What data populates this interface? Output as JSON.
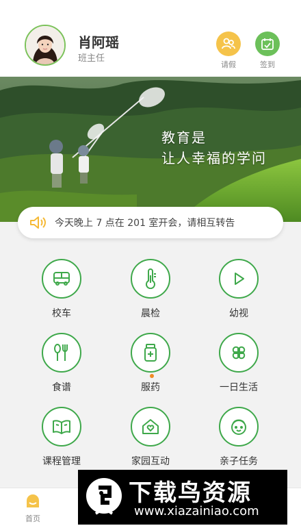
{
  "header": {
    "name": "肖阿瑶",
    "role": "班主任",
    "actions": [
      {
        "label": "请假",
        "icon": "leave-icon",
        "color": "#f5c34a"
      },
      {
        "label": "签到",
        "icon": "checkin-calendar-icon",
        "color": "#6cc05a"
      }
    ]
  },
  "banner": {
    "line1": "教育是",
    "line2": "让人幸福的学问"
  },
  "notice": {
    "icon": "speaker-icon",
    "text": "今天晚上 7 点在 201 室开会，请相互转告"
  },
  "grid": [
    {
      "label": "校车",
      "icon": "bus-icon"
    },
    {
      "label": "晨检",
      "icon": "thermometer-icon"
    },
    {
      "label": "幼视",
      "icon": "play-icon"
    },
    {
      "label": "食谱",
      "icon": "utensils-icon"
    },
    {
      "label": "服药",
      "icon": "medicine-icon"
    },
    {
      "label": "一日生活",
      "icon": "clover-icon"
    },
    {
      "label": "课程管理",
      "icon": "book-icon"
    },
    {
      "label": "家园互动",
      "icon": "home-heart-icon"
    },
    {
      "label": "亲子任务",
      "icon": "child-face-icon"
    }
  ],
  "tabs": [
    {
      "label": "首页",
      "icon": "home-tab-icon"
    }
  ],
  "watermark": {
    "title": "下载鸟资源",
    "url": "www.xiazainiao.com"
  },
  "colors": {
    "accent": "#3ea84a",
    "orange": "#f08a24",
    "yellow": "#f5c34a"
  }
}
